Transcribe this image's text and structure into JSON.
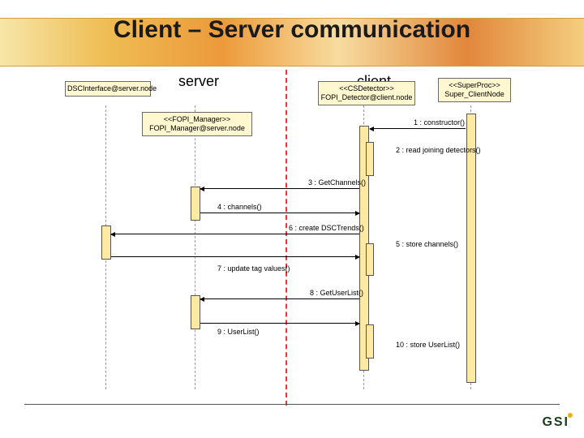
{
  "title": "Client – Server communication",
  "headers": {
    "server": "server",
    "client": "client"
  },
  "objects": {
    "dsc": {
      "line1": "DSCInterface@server.node"
    },
    "manager": {
      "line1": "<<FOPI_Manager>>",
      "line2": "FOPI_Manager@server.node"
    },
    "detector": {
      "line1": "<<CSDetector>>",
      "line2": "FOPI_Detector@client.node"
    },
    "super": {
      "line1": "<<SuperProc>>",
      "line2": "Super_ClientNode"
    }
  },
  "messages": {
    "m1": "1 : constructor()",
    "m2": "2 : read joining detectors()",
    "m3": "3 : GetChannels()",
    "m4": "4 : channels()",
    "m5": "5 : store channels()",
    "m6": "6 : create DSCTrends()",
    "m7": "7 : update tag values()",
    "m8": "8 : GetUserList()",
    "m9": "9 : UserList()",
    "m10": "10 : store UserList()"
  },
  "logo": "GSI"
}
